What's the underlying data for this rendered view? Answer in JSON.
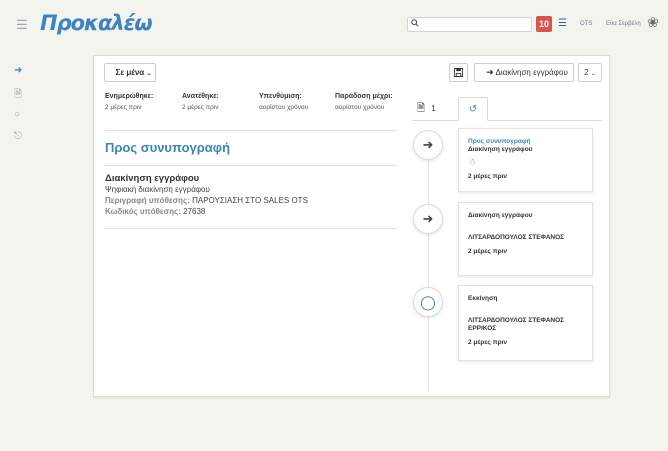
{
  "header": {
    "logo_text": "Προκαλέω",
    "search_placeholder": "",
    "notifications_count": "10",
    "department": "OTS",
    "user_name": "Εύα Σερβέλη"
  },
  "icons": {
    "menu": "hamburger-icon",
    "search": "search-icon",
    "list": "list-icon",
    "user_logo": "ornament-icon"
  },
  "toolbar": {
    "assign_label": "Σε μένα",
    "save_icon": "floppy-icon",
    "move_label": "Διακίνηση εγγράφου",
    "count_label": "2"
  },
  "meta": [
    {
      "label": "Ενημερώθηκε:",
      "value": "2 μέρες πριν"
    },
    {
      "label": "Ανατέθηκε:",
      "value": "2 μέρες πριν"
    },
    {
      "label": "Υπενθύμιση:",
      "value": "αορίστου χρόνου"
    },
    {
      "label": "Παράδοση μέχρι:",
      "value": "αορίστου χρόνου"
    }
  ],
  "main": {
    "section_title": "Προς συνυπογραφή",
    "doc_title": "Διακίνηση εγγράφου",
    "doc_type": "Ψηφιακή διακίνηση εγγράφου",
    "description_label": "Περιγραφή υπόθεσης:",
    "description_value": "ΠΑΡΟΥΣΙΑΣΗ ΣΤΟ SALES OTS",
    "code_label": "Κωδικός υπόθεσης:",
    "code_value": "27638"
  },
  "tabs": {
    "documents_count": "1"
  },
  "timeline": [
    {
      "title": "Προς συνυπογραφή",
      "subtitle": "Διακίνηση εγγράφου",
      "person": "",
      "time": "2 μέρες πριν"
    },
    {
      "title": "Διακίνηση εγγράφου",
      "subtitle": "",
      "person": "ΛΙΤΣΑΡΔΟΠΟΥΛΟΣ ΣΤΕΦΑΝΟΣ",
      "time": "2 μέρες πριν"
    },
    {
      "title": "Εκκίνηση",
      "subtitle": "",
      "person": "ΛΙΤΣΑΡΔΟΠΟΥΛΟΣ ΣΤΕΦΑΝΟΣ ΕΡΡΙΚΟΣ",
      "time": "2 μέρες πριν"
    }
  ],
  "colors": {
    "accent": "#3d82c2",
    "badge": "#d9534f",
    "background": "#f4f4ee"
  }
}
